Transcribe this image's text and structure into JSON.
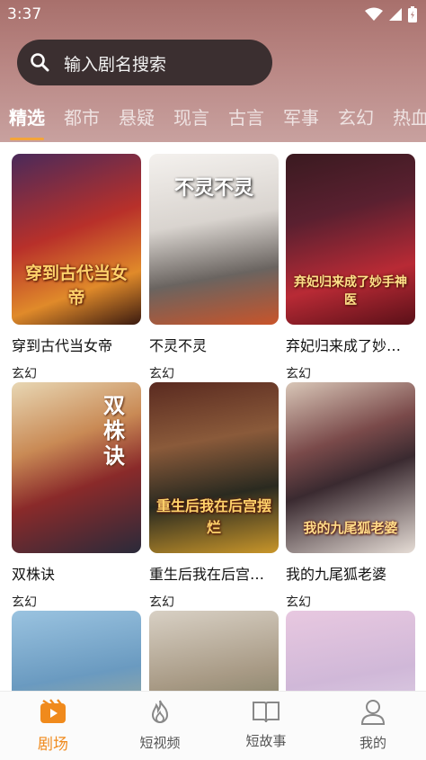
{
  "status_bar": {
    "time": "3:37"
  },
  "search": {
    "placeholder": "输入剧名搜索"
  },
  "tabs": [
    {
      "label": "精选",
      "active": true
    },
    {
      "label": "都市",
      "active": false
    },
    {
      "label": "悬疑",
      "active": false
    },
    {
      "label": "现言",
      "active": false
    },
    {
      "label": "古言",
      "active": false
    },
    {
      "label": "军事",
      "active": false
    },
    {
      "label": "玄幻",
      "active": false
    },
    {
      "label": "热血",
      "active": false
    }
  ],
  "dramas": [
    {
      "title": "穿到古代当女帝",
      "tag": "玄幻",
      "poster_text": "穿到古代当女帝"
    },
    {
      "title": "不灵不灵",
      "tag": "玄幻",
      "poster_text": "不灵不灵"
    },
    {
      "title": "弃妃归来成了妙…",
      "tag": "玄幻",
      "poster_text": "弃妃归来成了妙手神医"
    },
    {
      "title": "双株诀",
      "tag": "玄幻",
      "poster_text": "双株诀"
    },
    {
      "title": "重生后我在后宫…",
      "tag": "玄幻",
      "poster_text": "重生后我在后宫摆烂"
    },
    {
      "title": "我的九尾狐老婆",
      "tag": "玄幻",
      "poster_text": "我的九尾狐老婆"
    },
    {
      "title": "",
      "tag": "",
      "poster_text": ""
    },
    {
      "title": "",
      "tag": "",
      "poster_text": ""
    },
    {
      "title": "",
      "tag": "",
      "poster_text": ""
    }
  ],
  "bottom_nav": [
    {
      "label": "剧场",
      "icon": "theater-icon",
      "active": true
    },
    {
      "label": "短视频",
      "icon": "flame-icon",
      "active": false
    },
    {
      "label": "短故事",
      "icon": "book-icon",
      "active": false
    },
    {
      "label": "我的",
      "icon": "person-icon",
      "active": false
    }
  ],
  "colors": {
    "accent": "#f08a1c",
    "search_bg": "#3b2f30",
    "header_top": "#a8706c"
  }
}
